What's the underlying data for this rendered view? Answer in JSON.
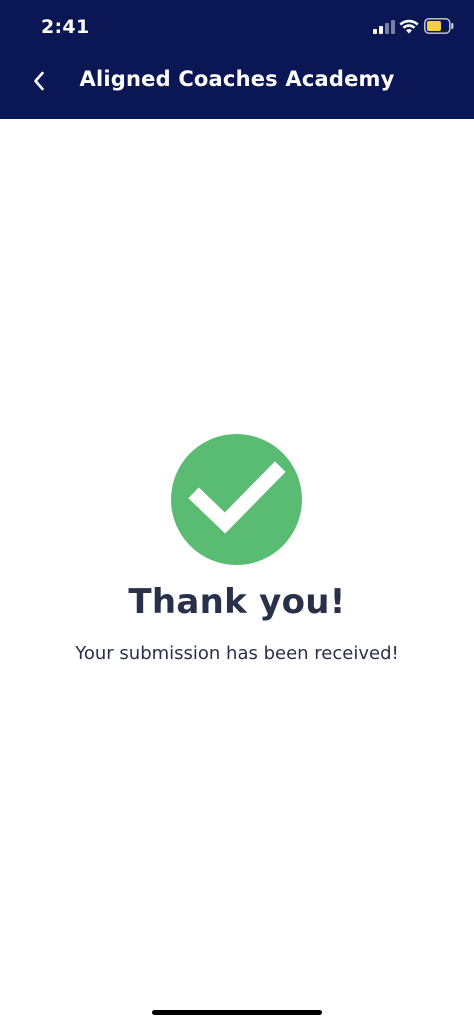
{
  "status_bar": {
    "time": "2:41",
    "icons": [
      "signal-icon",
      "wifi-icon",
      "battery-icon"
    ]
  },
  "nav": {
    "back_icon": "chevron-left-icon",
    "title": "Aligned Coaches Academy"
  },
  "confirmation": {
    "icon": "checkmark-circle-icon",
    "title": "Thank you!",
    "message": "Your submission has been received!"
  },
  "colors": {
    "header_bg": "#0b1654",
    "success_green": "#5abb73",
    "text_dark": "#28304a",
    "battery_yellow": "#f4d03f"
  }
}
